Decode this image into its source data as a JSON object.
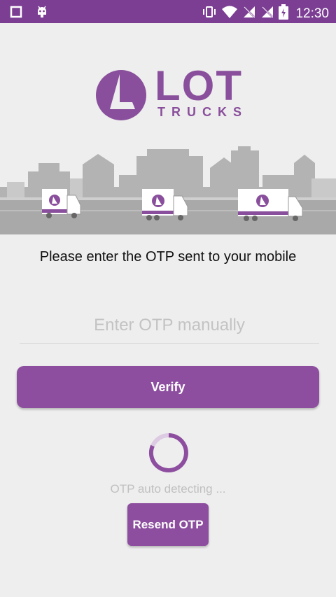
{
  "status_bar": {
    "time": "12:30",
    "icons": [
      "square-notification-icon",
      "android-debug-icon",
      "vibrate-icon",
      "wifi-icon",
      "no-sim-icon",
      "no-sim-icon",
      "battery-charging-icon"
    ]
  },
  "logo": {
    "main": "LOT",
    "sub": "TRUCKS"
  },
  "instruction": "Please enter the OTP sent to your mobile",
  "otp_field": {
    "placeholder": "Enter OTP manually",
    "value": ""
  },
  "verify_label": "Verify",
  "auto_detect_text": "OTP auto detecting ...",
  "resend_label": "Resend OTP",
  "colors": {
    "status_bar": "#7b3e93",
    "accent": "#8d4e9f",
    "background": "#eeeeee"
  }
}
